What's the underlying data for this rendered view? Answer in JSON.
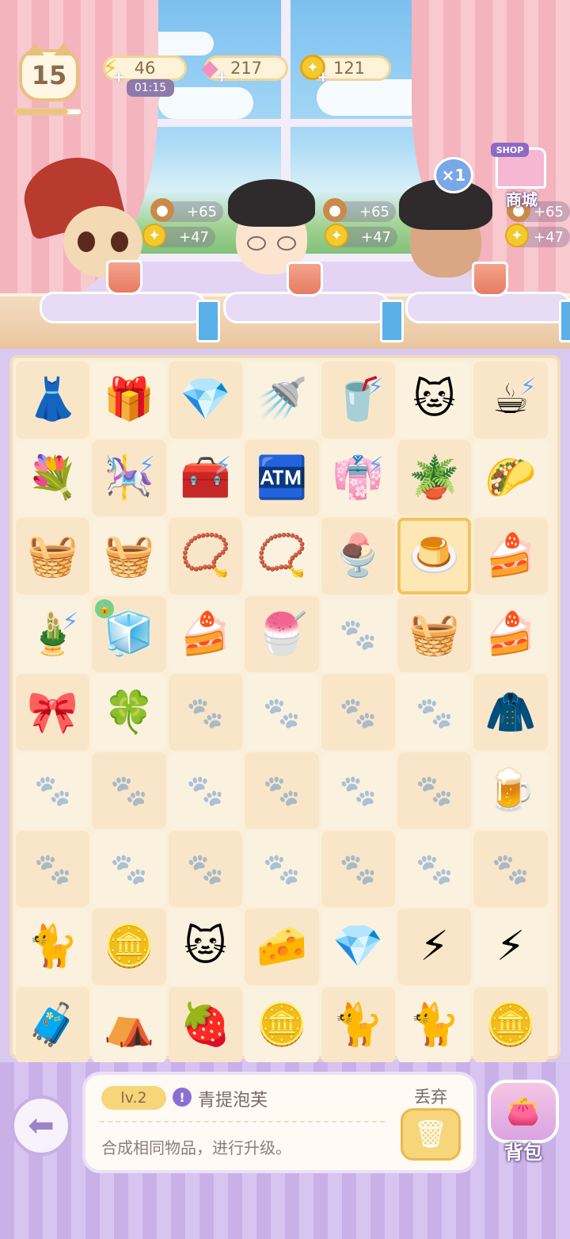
{
  "header": {
    "level": "15",
    "xp_progress": 0.8,
    "energy": {
      "icon": "lightning-icon",
      "value": "46",
      "timer": "01:15"
    },
    "gems": {
      "icon": "gem-icon",
      "value": "217"
    },
    "coins": {
      "icon": "coin-icon",
      "value": "121"
    }
  },
  "customers": [
    {
      "name": "witch-cat",
      "acorn_reward": "+65",
      "coin_reward": "+47"
    },
    {
      "name": "glasses-boy",
      "acorn_reward": "+65",
      "coin_reward": "+47"
    },
    {
      "name": "dark-hair-boy",
      "acorn_reward": "+65",
      "coin_reward": "+47"
    }
  ],
  "multiplier": "×1",
  "shop": {
    "sign": "SHOP",
    "label": "商城"
  },
  "board": {
    "cells": [
      {
        "icon": "👗",
        "name": "dress"
      },
      {
        "icon": "🎁",
        "name": "gift-box"
      },
      {
        "icon": "💎",
        "name": "gems"
      },
      {
        "icon": "🚿",
        "name": "watering-can"
      },
      {
        "icon": "🥤",
        "name": "glass-generator",
        "bolt": true
      },
      {
        "icon": "🐱",
        "name": "lucky-cat"
      },
      {
        "icon": "☕",
        "name": "coffee-generator",
        "bolt": true
      },
      {
        "icon": "💐",
        "name": "bouquet"
      },
      {
        "icon": "🎠",
        "name": "swing-generator",
        "bolt": true
      },
      {
        "icon": "🧰",
        "name": "chest-generator",
        "bolt": true
      },
      {
        "icon": "🏧",
        "name": "vending-machine"
      },
      {
        "icon": "👘",
        "name": "clothes-rack-generator",
        "bolt": true
      },
      {
        "icon": "🪴",
        "name": "garden-set"
      },
      {
        "icon": "🌮",
        "name": "taco-cat"
      },
      {
        "icon": "🧺",
        "name": "flower-basket"
      },
      {
        "icon": "🧺",
        "name": "flower-basket"
      },
      {
        "icon": "📿",
        "name": "earrings"
      },
      {
        "icon": "📿",
        "name": "earrings"
      },
      {
        "icon": "🍨",
        "name": "parfait"
      },
      {
        "icon": "🍮",
        "name": "green-grape-puff",
        "selected": true
      },
      {
        "icon": "🍰",
        "name": "strawberry-cake"
      },
      {
        "icon": "🎍",
        "name": "plant-generator",
        "bolt": true
      },
      {
        "icon": "🧊",
        "name": "locked-box",
        "locked": true
      },
      {
        "icon": "🍰",
        "name": "strawberry-cake"
      },
      {
        "icon": "🍧",
        "name": "strawberry-drink"
      },
      {
        "icon": "",
        "name": "empty"
      },
      {
        "icon": "🧺",
        "name": "flower-basket"
      },
      {
        "icon": "🍰",
        "name": "strawberry-cake"
      },
      {
        "icon": "🎀",
        "name": "bows"
      },
      {
        "icon": "🍀",
        "name": "clover"
      },
      {
        "icon": "",
        "name": "empty"
      },
      {
        "icon": "",
        "name": "empty"
      },
      {
        "icon": "",
        "name": "empty"
      },
      {
        "icon": "",
        "name": "empty"
      },
      {
        "icon": "🧥",
        "name": "jacket"
      },
      {
        "icon": "",
        "name": "empty"
      },
      {
        "icon": "",
        "name": "empty"
      },
      {
        "icon": "",
        "name": "empty"
      },
      {
        "icon": "",
        "name": "empty"
      },
      {
        "icon": "",
        "name": "empty"
      },
      {
        "icon": "",
        "name": "empty"
      },
      {
        "icon": "🍺",
        "name": "juice-mug"
      },
      {
        "icon": "",
        "name": "empty"
      },
      {
        "icon": "",
        "name": "empty"
      },
      {
        "icon": "",
        "name": "empty"
      },
      {
        "icon": "",
        "name": "empty"
      },
      {
        "icon": "",
        "name": "empty"
      },
      {
        "icon": "",
        "name": "empty"
      },
      {
        "icon": "",
        "name": "empty"
      },
      {
        "icon": "🐈",
        "name": "brown-cat"
      },
      {
        "icon": "🪙",
        "name": "coin"
      },
      {
        "icon": "🐱",
        "name": "white-cat"
      },
      {
        "icon": "🧀",
        "name": "cheese"
      },
      {
        "icon": "💎",
        "name": "pink-gems"
      },
      {
        "icon": "⚡",
        "name": "energy-bolt"
      },
      {
        "icon": "⚡",
        "name": "double-energy"
      },
      {
        "icon": "🧳",
        "name": "suitcase"
      },
      {
        "icon": "⛺",
        "name": "tent"
      },
      {
        "icon": "🍓",
        "name": "berry-jar"
      },
      {
        "icon": "🪙",
        "name": "coin-pile"
      },
      {
        "icon": "🐈",
        "name": "calico-cat"
      },
      {
        "icon": "🐈",
        "name": "siamese-cat"
      },
      {
        "icon": "🪙",
        "name": "coin-stack"
      }
    ]
  },
  "info_panel": {
    "level": "lv.2",
    "item_name": "青提泡芙",
    "description": "合成相同物品，进行升级。",
    "discard_label": "丢弃"
  },
  "bag_label": "背包",
  "colors": {
    "board_bg": "#fbefd9",
    "accent": "#f6d57b",
    "purple": "#c9b1e8"
  }
}
